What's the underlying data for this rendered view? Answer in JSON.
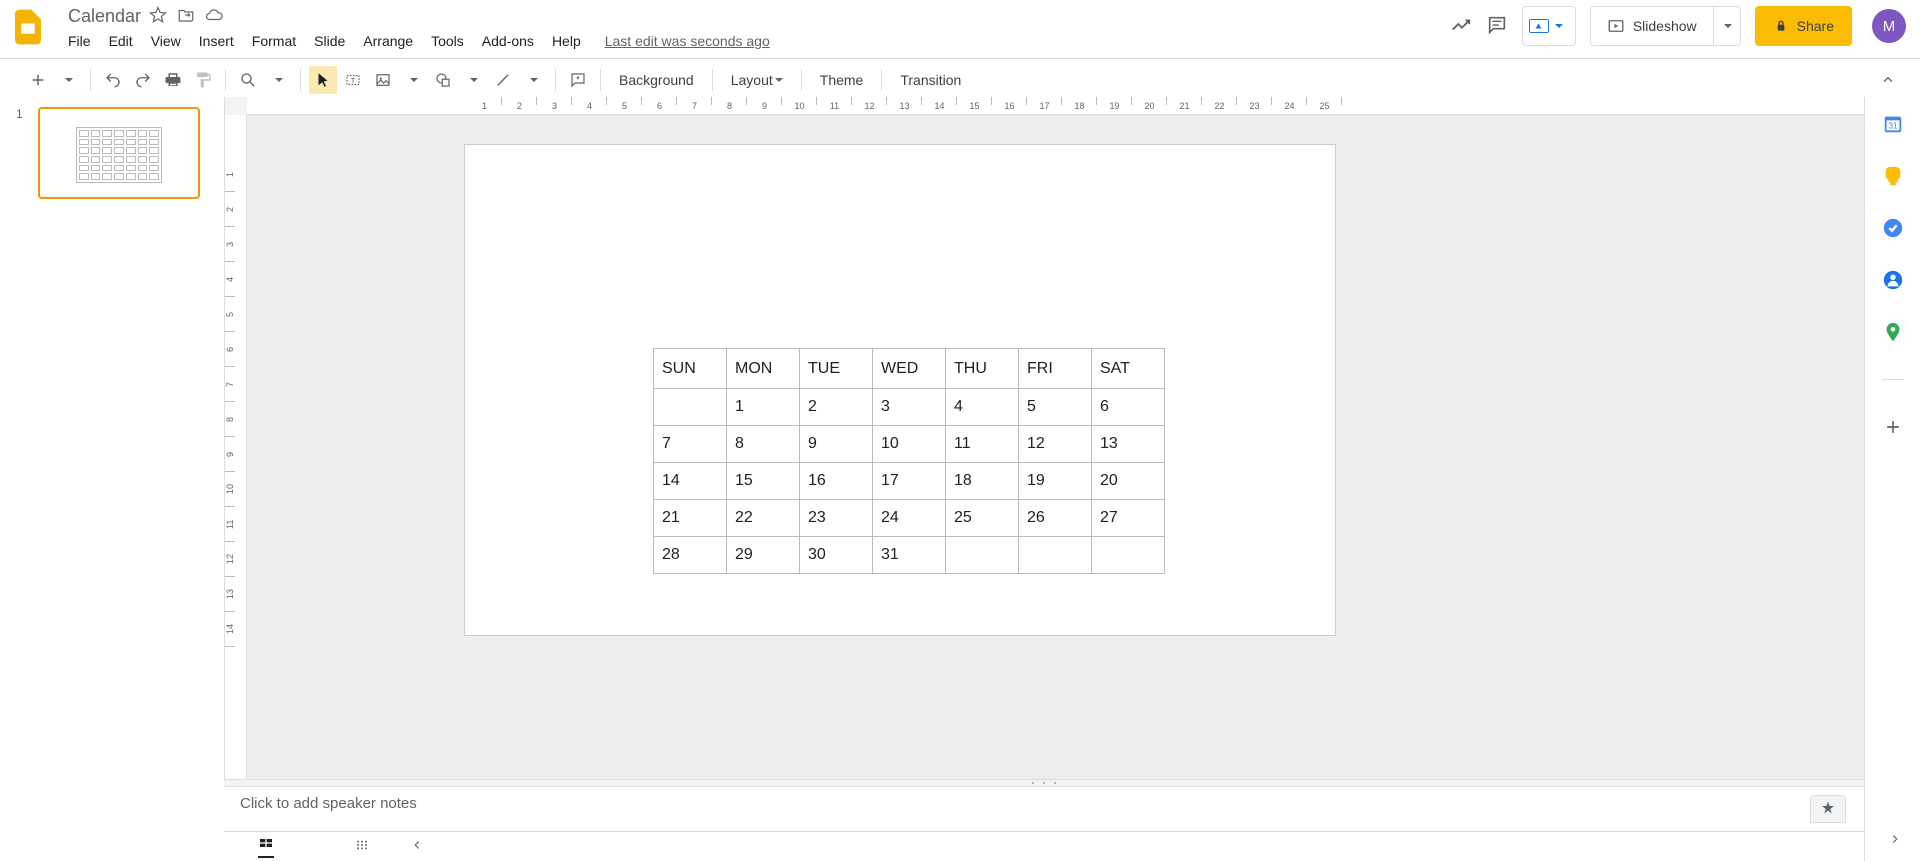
{
  "header": {
    "title": "Calendar",
    "last_edit": "Last edit was seconds ago",
    "slideshow": "Slideshow",
    "share": "Share",
    "avatar_letter": "M"
  },
  "menu": [
    "File",
    "Edit",
    "View",
    "Insert",
    "Format",
    "Slide",
    "Arrange",
    "Tools",
    "Add-ons",
    "Help"
  ],
  "toolbar": {
    "background": "Background",
    "layout": "Layout",
    "theme": "Theme",
    "transition": "Transition"
  },
  "filmstrip": {
    "slide_number": "1"
  },
  "ruler_h": [
    "1",
    "2",
    "3",
    "4",
    "5",
    "6",
    "7",
    "8",
    "9",
    "10",
    "11",
    "12",
    "13",
    "14",
    "15",
    "16",
    "17",
    "18",
    "19",
    "20",
    "21",
    "22",
    "23",
    "24",
    "25"
  ],
  "ruler_v": [
    "1",
    "2",
    "3",
    "4",
    "5",
    "6",
    "7",
    "8",
    "9",
    "10",
    "11",
    "12",
    "13",
    "14"
  ],
  "calendar": {
    "headers": [
      "SUN",
      "MON",
      "TUE",
      "WED",
      "THU",
      "FRI",
      "SAT"
    ],
    "rows": [
      [
        "",
        "1",
        "2",
        "3",
        "4",
        "5",
        "6"
      ],
      [
        "7",
        "8",
        "9",
        "10",
        "11",
        "12",
        "13"
      ],
      [
        "14",
        "15",
        "16",
        "17",
        "18",
        "19",
        "20"
      ],
      [
        "21",
        "22",
        "23",
        "24",
        "25",
        "26",
        "27"
      ],
      [
        "28",
        "29",
        "30",
        "31",
        "",
        "",
        ""
      ]
    ]
  },
  "notes": {
    "placeholder": "Click to add speaker notes"
  }
}
